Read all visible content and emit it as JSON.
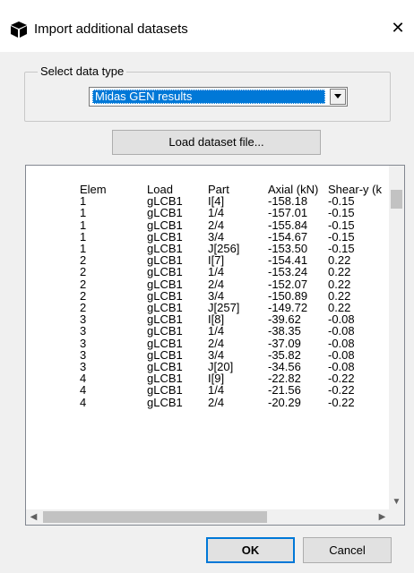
{
  "dialog": {
    "title": "Import additional datasets",
    "close_icon": "close-icon",
    "app_icon": "cube-icon"
  },
  "data_type": {
    "group_label": "Select data type",
    "selected_value": "Midas GEN results"
  },
  "load_button_label": "Load dataset file...",
  "dataset": {
    "headers": [
      "Elem",
      "Load",
      "Part",
      "Axial (kN)",
      "Shear-y (k"
    ],
    "rows": [
      [
        "1",
        "gLCB1",
        "I[4]",
        "-158.18",
        "-0.15"
      ],
      [
        "1",
        "gLCB1",
        "1/4",
        "-157.01",
        "-0.15"
      ],
      [
        "1",
        "gLCB1",
        "2/4",
        "-155.84",
        "-0.15"
      ],
      [
        "1",
        "gLCB1",
        "3/4",
        "-154.67",
        "-0.15"
      ],
      [
        "1",
        "gLCB1",
        "J[256]",
        "-153.50",
        "-0.15"
      ],
      [
        "2",
        "gLCB1",
        "I[7]",
        "-154.41",
        "0.22"
      ],
      [
        "2",
        "gLCB1",
        "1/4",
        "-153.24",
        "0.22"
      ],
      [
        "2",
        "gLCB1",
        "2/4",
        "-152.07",
        "0.22"
      ],
      [
        "2",
        "gLCB1",
        "3/4",
        "-150.89",
        "0.22"
      ],
      [
        "2",
        "gLCB1",
        "J[257]",
        "-149.72",
        "0.22"
      ],
      [
        "3",
        "gLCB1",
        "I[8]",
        "-39.62",
        "-0.08"
      ],
      [
        "3",
        "gLCB1",
        "1/4",
        "-38.35",
        "-0.08"
      ],
      [
        "3",
        "gLCB1",
        "2/4",
        "-37.09",
        "-0.08"
      ],
      [
        "3",
        "gLCB1",
        "3/4",
        "-35.82",
        "-0.08"
      ],
      [
        "3",
        "gLCB1",
        "J[20]",
        "-34.56",
        "-0.08"
      ],
      [
        "4",
        "gLCB1",
        "I[9]",
        "-22.82",
        "-0.22"
      ],
      [
        "4",
        "gLCB1",
        "1/4",
        "-21.56",
        "-0.22"
      ],
      [
        "4",
        "gLCB1",
        "2/4",
        "-20.29",
        "-0.22"
      ]
    ]
  },
  "buttons": {
    "ok_label": "OK",
    "cancel_label": "Cancel"
  }
}
